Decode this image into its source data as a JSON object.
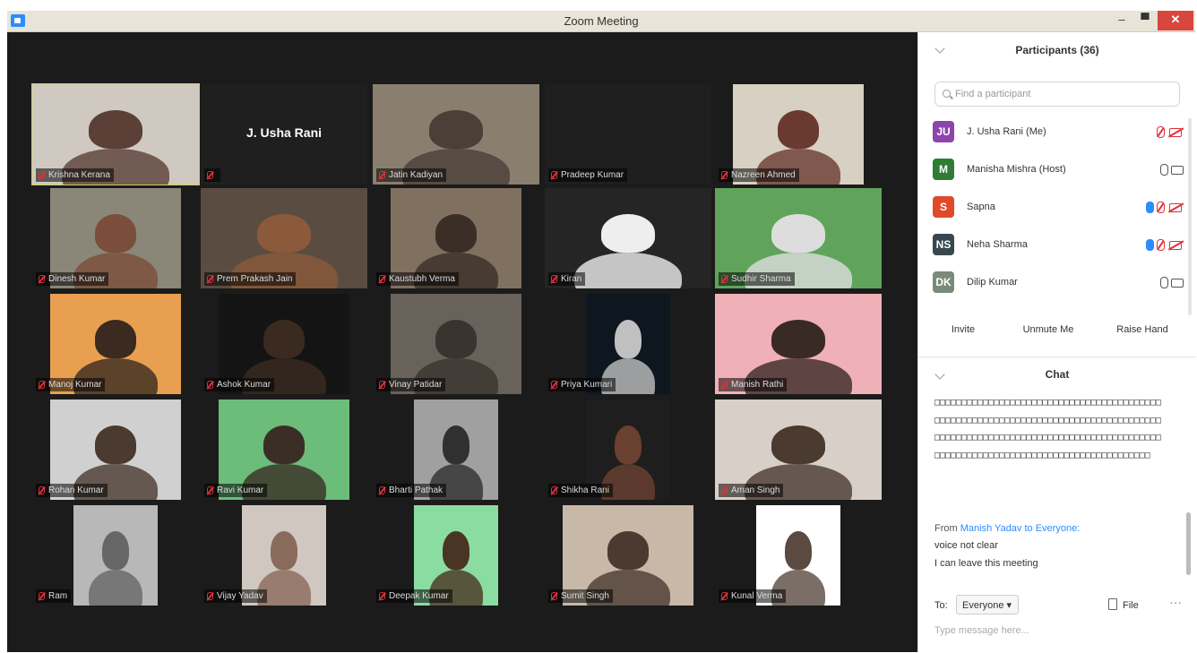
{
  "window": {
    "title": "Zoom Meeting",
    "minimize": "–",
    "maximize": "▀",
    "close": "✕"
  },
  "tiles": [
    {
      "name": "Krishna Kerana",
      "active": true,
      "bg": "#cfc9c2",
      "person": "#5a4036",
      "style": "full"
    },
    {
      "name": "",
      "display_name": "J. Usha Rani",
      "bg": "#1f1f1f",
      "style": "none"
    },
    {
      "name": "Jatin Kadiyan",
      "bg": "#8a7e6e",
      "person": "#4a4038",
      "style": "full"
    },
    {
      "name": "Pradeep Kumar",
      "bg": "#1f1f1f",
      "style": "none"
    },
    {
      "name": "Nazreen Ahmed",
      "bg": "#d8d0c2",
      "person": "#6a3a30",
      "style": "mid"
    },
    {
      "name": "Dinesh Kumar",
      "bg": "#8a8678",
      "person": "#7a4e3a",
      "style": "mid"
    },
    {
      "name": "Prem Prakash Jain",
      "bg": "#5a4c40",
      "person": "#8a5a3a",
      "style": "full"
    },
    {
      "name": "Kaustubh Verma",
      "bg": "#807060",
      "person": "#3a2e26",
      "style": "mid"
    },
    {
      "name": "Kiran",
      "bg": "#252525",
      "person": "#eeeeee",
      "style": "full"
    },
    {
      "name": "Sudhir Sharma",
      "bg": "#5fa45a",
      "person": "#ddd",
      "style": "full"
    },
    {
      "name": "Manoj Kumar",
      "bg": "#e8a050",
      "person": "#3a2a20",
      "style": "mid"
    },
    {
      "name": "Ashok Kumar",
      "bg": "#141414",
      "person": "#3a2a20",
      "style": "mid"
    },
    {
      "name": "Vinay Patidar",
      "bg": "#68625a",
      "person": "#3a3430",
      "style": "mid"
    },
    {
      "name": "Priya Kumari",
      "bg": "#0e1620",
      "person": "#c0c0c0",
      "style": "narrow"
    },
    {
      "name": "Manish Rathi",
      "bg": "#f0b0b8",
      "person": "#3a2a26",
      "style": "full"
    },
    {
      "name": "Rohan Kumar",
      "bg": "#d0d0d0",
      "person": "#4a3a30",
      "style": "mid"
    },
    {
      "name": "Ravi Kumar",
      "bg": "#6cbc7a",
      "person": "#3a2e26",
      "style": "mid"
    },
    {
      "name": "Bharti Pathak",
      "bg": "#a0a0a0",
      "person": "#303030",
      "style": "narrow"
    },
    {
      "name": "Shikha Rani",
      "bg": "#1e1e1e",
      "person": "#6a4030",
      "style": "narrow"
    },
    {
      "name": "Aman Singh",
      "bg": "#d8d0c8",
      "person": "#4a3a30",
      "style": "full"
    },
    {
      "name": "Ram",
      "bg": "#b8b8b8",
      "person": "#666",
      "style": "narrow"
    },
    {
      "name": "Vijay Yadav",
      "bg": "#d0c8c0",
      "person": "#8a6a5a",
      "style": "narrow"
    },
    {
      "name": "Deepak Kumar",
      "bg": "#8adca0",
      "person": "#4a3424",
      "style": "narrow"
    },
    {
      "name": "Sumit Singh",
      "bg": "#c8b8a8",
      "person": "#4a3a30",
      "style": "mid"
    },
    {
      "name": "Kunal Verma",
      "bg": "#ffffff",
      "person": "#5a4a40",
      "style": "narrow"
    }
  ],
  "participants_panel": {
    "title": "Participants (36)",
    "search_placeholder": "Find a participant",
    "items": [
      {
        "initials": "JU",
        "color": "#8e44ad",
        "name": "J. Usha Rani (Me)"
      },
      {
        "initials": "M",
        "color": "#2e7d32",
        "name": "Manisha Mishra (Host)"
      },
      {
        "initials": "S",
        "color": "#e04a2a",
        "name": "Sapna"
      },
      {
        "initials": "NS",
        "color": "#37474f",
        "name": "Neha Sharma"
      },
      {
        "initials": "DK",
        "color": "#7a8a7a",
        "name": "Dilip Kumar"
      }
    ],
    "buttons": {
      "invite": "Invite",
      "unmute": "Unmute Me",
      "raise": "Raise Hand"
    }
  },
  "chat": {
    "title": "Chat",
    "messages_text": "□□□□□□□□□□□□□□□□□□□□□□□□□□□□□□□□□□□□□□□□□□□□□□□□□□□□□□□□□□□□□□□□□□□□□□□□□□□□□□□□□□□□□□□□□□□□□□□□□□□□□□□□□□□□□□□□□□□□□□□□□□□□□□□□□□□□□□□□□□□□□□□□□□□□□□□□□□□□□□□□□□□□□□",
    "from_prefix": "From",
    "from_name": "Manish Yadav to Everyone:",
    "line1": "voice not clear",
    "line2": "I can leave this meeting",
    "to_label": "To:",
    "to_value": "Everyone ▾",
    "file_label": "File",
    "more": "···",
    "message_placeholder": "Type message here..."
  },
  "colors": {
    "video_bg": "#1b1b1b",
    "active_speaker": "#c8d64a",
    "mute_red": "#e0303a",
    "zoom_blue": "#2d8cff"
  }
}
